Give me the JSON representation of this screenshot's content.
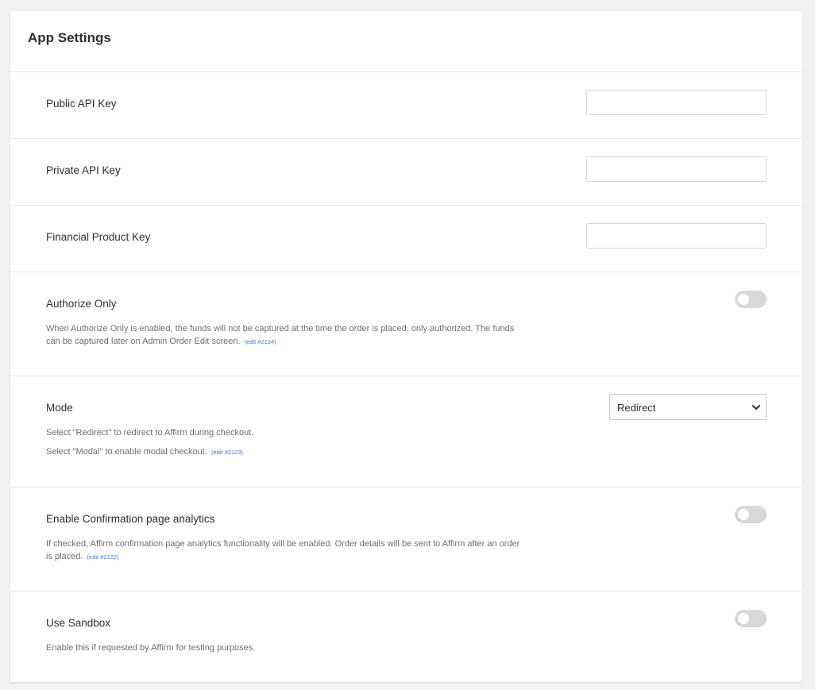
{
  "panel": {
    "title": "App Settings"
  },
  "settings": {
    "public_api_key": {
      "label": "Public API Key",
      "value": ""
    },
    "private_api_key": {
      "label": "Private API Key",
      "value": ""
    },
    "financial_product_key": {
      "label": "Financial Product Key",
      "value": ""
    },
    "authorize_only": {
      "label": "Authorize Only",
      "description": "When Authorize Only is enabled, the funds will not be captured at the time the order is placed, only authorized. The funds can be captured later on Admin Order Edit screen.",
      "edit_link": "(edit #2124)",
      "enabled": false
    },
    "mode": {
      "label": "Mode",
      "selected": "Redirect",
      "description_line1": "Select \"Redirect\" to redirect to Affirm during checkout.",
      "description_line2": "Select \"Modal\" to enable modal checkout.",
      "edit_link": "(edit #2123)"
    },
    "confirmation_analytics": {
      "label": "Enable Confirmation page analytics",
      "description": "If checked, Affirm confirmation page analytics functionality will be enabled.  Order details will be sent to Affirm after an order is placed.",
      "edit_link": "(edit #2122)",
      "enabled": false
    },
    "use_sandbox": {
      "label": "Use Sandbox",
      "description": "Enable this if requested by Affirm for testing purposes.",
      "enabled": false
    }
  },
  "icons": {
    "select_chevron": "chevron-down-icon"
  },
  "colors": {
    "toggle_off": "#d7d8da",
    "link": "#3a7bd5",
    "page_background": "#f0f1f3"
  }
}
